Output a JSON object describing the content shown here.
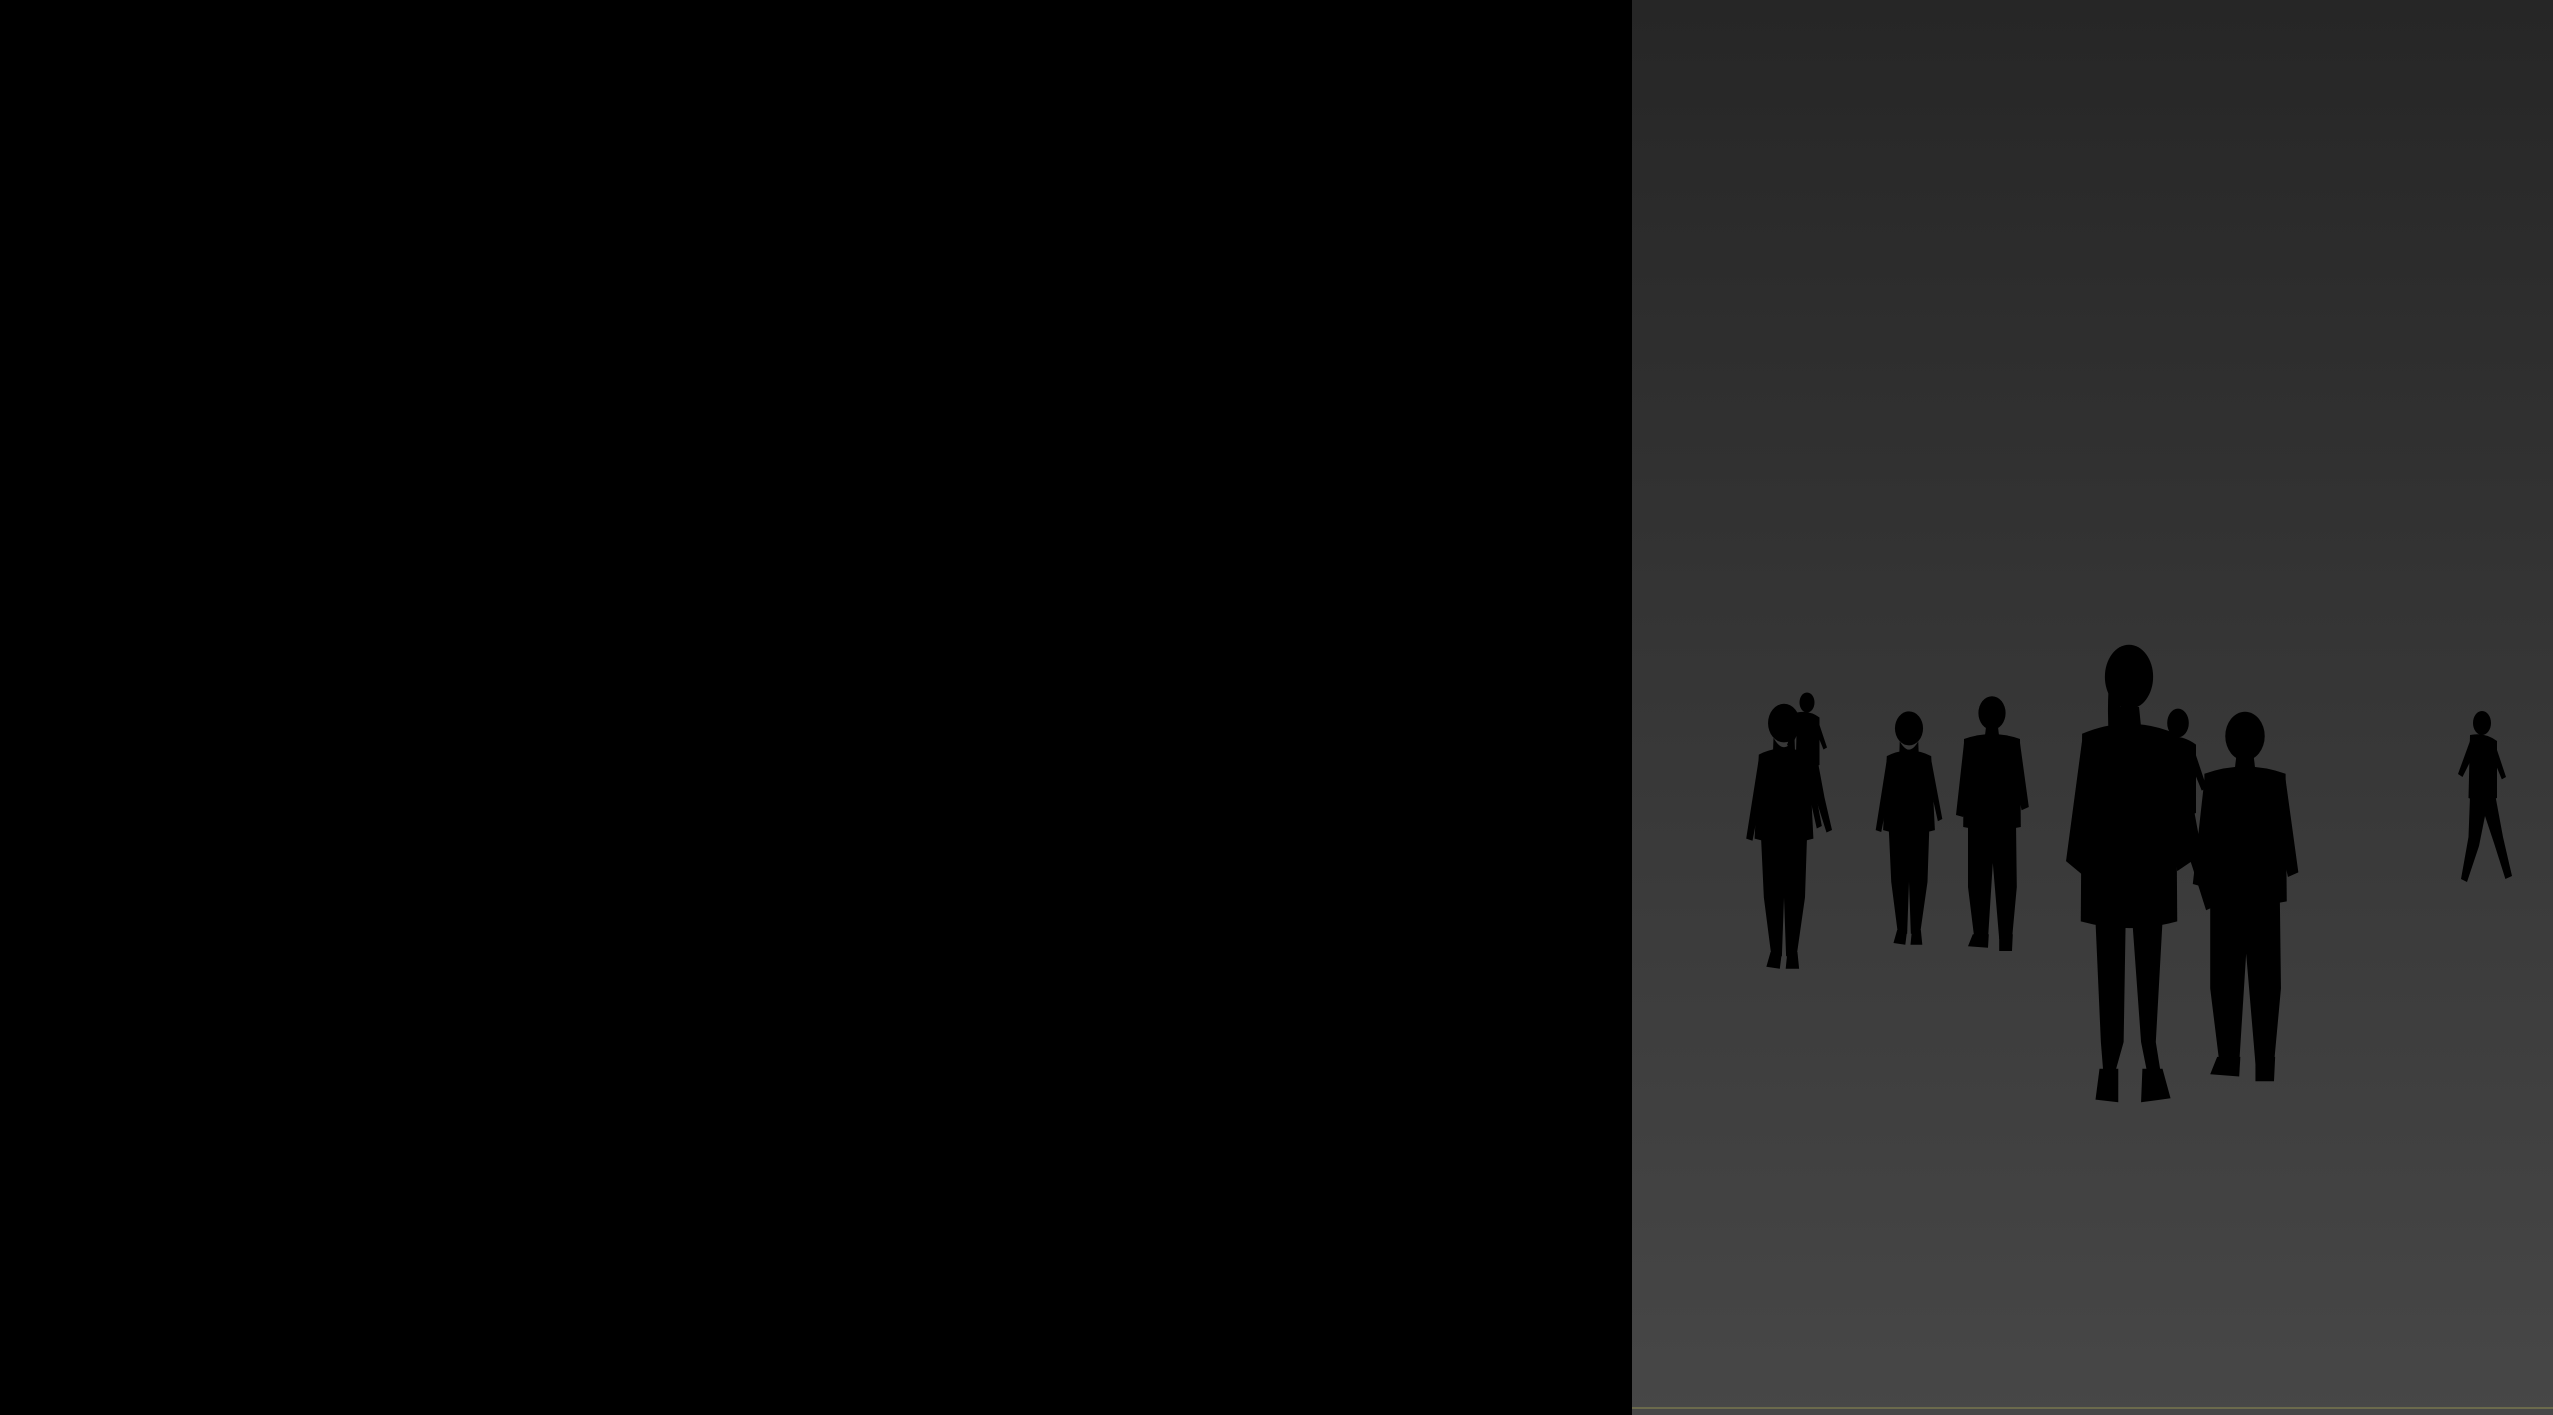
{
  "window": {
    "panels": [
      {
        "id": "render-view",
        "kind": "rendered-frame",
        "background": "#000000"
      },
      {
        "id": "perspective-viewport",
        "kind": "3d-viewport",
        "background_top": "#262626",
        "background_bottom": "#474747"
      }
    ]
  },
  "scene": {
    "figure_count": 8,
    "material_color": "#e6e6e6",
    "figures": [
      {
        "name": "woman-long-hair-back"
      },
      {
        "name": "man-walking-back-left"
      },
      {
        "name": "woman-ponytail-back"
      },
      {
        "name": "man-shirt-back"
      },
      {
        "name": "woman-front-dress"
      },
      {
        "name": "couple-walking-center"
      },
      {
        "name": "man-bald-back"
      },
      {
        "name": "woman-walking-right"
      }
    ]
  }
}
